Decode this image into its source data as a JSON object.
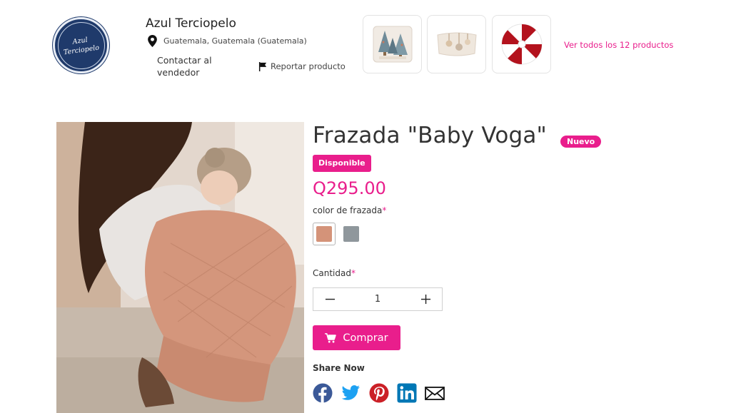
{
  "seller": {
    "logo_line1": "Azul",
    "logo_line2": "Terciopelo",
    "name": "Azul Terciopelo",
    "location": "Guatemala, Guatemala (Guatemala)",
    "contact_label": "Contactar al vendedor",
    "report_label": "Reportar producto",
    "view_all_label": "Ver todos los 12 productos"
  },
  "product": {
    "title": "Frazada \"Baby Voga\"",
    "new_badge": "Nuevo",
    "availability": "Disponible",
    "price": "Q295.00",
    "option_label": "color de frazada",
    "required_mark": "*",
    "swatches": [
      {
        "color": "#d49379",
        "selected": true
      },
      {
        "color": "#8f979c",
        "selected": false
      }
    ],
    "quantity_label": "Cantidad",
    "quantity_value": "1",
    "buy_label": "Comprar",
    "share_label": "Share Now"
  },
  "icons": {
    "location": "location-pin-icon",
    "report": "flag-icon",
    "cart": "cart-icon",
    "minus": "minus-icon",
    "plus": "plus-icon",
    "share": [
      "facebook-icon",
      "twitter-icon",
      "pinterest-icon",
      "linkedin-icon",
      "email-icon"
    ]
  },
  "colors": {
    "accent": "#e91e8c",
    "logo_bg": "#1f3a6b",
    "facebook": "#3b5998",
    "twitter": "#1da1f2",
    "pinterest": "#cb2027",
    "linkedin": "#0077b5"
  }
}
